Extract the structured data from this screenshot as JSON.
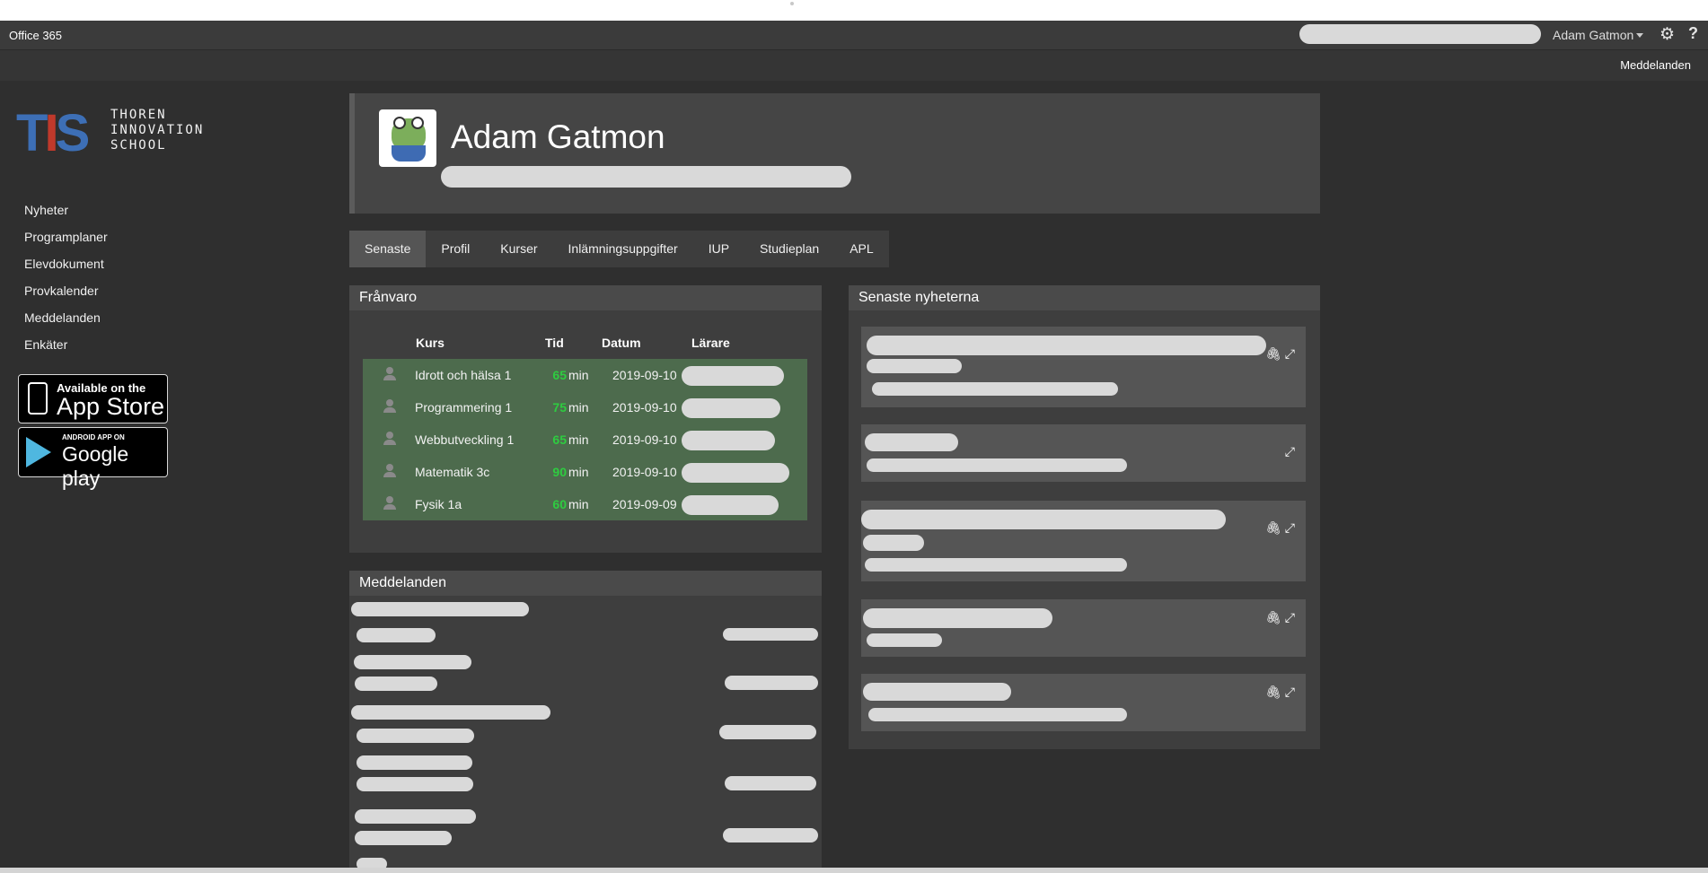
{
  "o365": {
    "title": "Office 365",
    "user": "Adam Gatmon"
  },
  "subbar": {
    "messages_link": "Meddelanden"
  },
  "logo": {
    "mark": [
      "T",
      "I",
      "S"
    ],
    "lines": [
      "THOREN",
      "INNOVATION",
      "SCHOOL"
    ]
  },
  "nav": [
    "Nyheter",
    "Programplaner",
    "Elevdokument",
    "Provkalender",
    "Meddelanden",
    "Enkäter"
  ],
  "badges": {
    "appstore": {
      "line1": "Available on the",
      "line2": "App Store"
    },
    "googleplay": {
      "line1": "ANDROID APP ON",
      "line2": "Google play"
    }
  },
  "profile": {
    "name": "Adam Gatmon"
  },
  "tabs": [
    {
      "label": "Senaste",
      "active": true
    },
    {
      "label": "Profil",
      "active": false
    },
    {
      "label": "Kurser",
      "active": false
    },
    {
      "label": "Inlämningsuppgifter",
      "active": false
    },
    {
      "label": "IUP",
      "active": false
    },
    {
      "label": "Studieplan",
      "active": false
    },
    {
      "label": "APL",
      "active": false
    }
  ],
  "absence": {
    "title": "Frånvaro",
    "columns": [
      "Kurs",
      "Tid",
      "Datum",
      "Lärare"
    ],
    "unit": "min",
    "rows": [
      {
        "course": "Idrott och hälsa 1",
        "time": "65",
        "date": "2019-09-10"
      },
      {
        "course": "Programmering 1",
        "time": "75",
        "date": "2019-09-10"
      },
      {
        "course": "Webbutveckling 1",
        "time": "65",
        "date": "2019-09-10"
      },
      {
        "course": "Matematik 3c",
        "time": "90",
        "date": "2019-09-10"
      },
      {
        "course": "Fysik 1a",
        "time": "60",
        "date": "2019-09-09"
      }
    ]
  },
  "messages": {
    "title": "Meddelanden"
  },
  "news": {
    "title": "Senaste nyheterna"
  },
  "colors": {
    "background": "#2f2f2f",
    "panel": "#3e3e3e",
    "absence_rows": "#4d6b4d",
    "time_value": "#2ecc40"
  }
}
